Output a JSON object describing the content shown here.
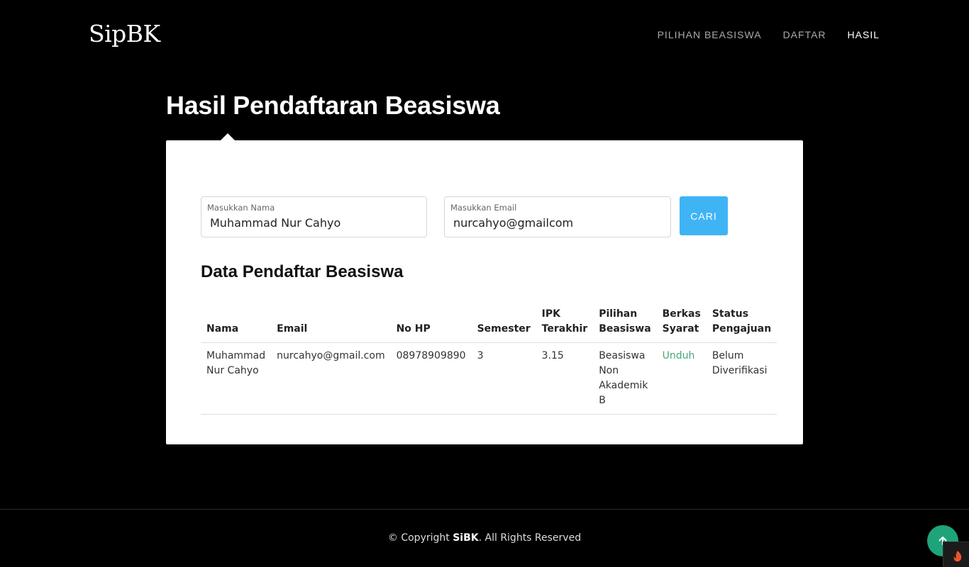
{
  "brand": {
    "logo": "SipBK"
  },
  "nav": {
    "items": [
      {
        "label": "PILIHAN BEASISWA",
        "active": false
      },
      {
        "label": "DAFTAR",
        "active": false
      },
      {
        "label": "HASIL",
        "active": true
      }
    ]
  },
  "page": {
    "title": "Hasil Pendaftaran Beasiswa"
  },
  "search": {
    "name_label": "Masukkan Nama",
    "name_value": "Muhammad Nur Cahyo",
    "email_label": "Masukkan Email",
    "email_value": "nurcahyo@gmailcom",
    "button_label": "CARI"
  },
  "results": {
    "title": "Data Pendaftar Beasiswa",
    "columns": [
      "Nama",
      "Email",
      "No HP",
      "Semester",
      "IPK Terakhir",
      "Pilihan Beasiswa",
      "Berkas Syarat",
      "Status Pengajuan"
    ],
    "rows": [
      {
        "nama": "Muhammad Nur Cahyo",
        "email": "nurcahyo@gmail.com",
        "no_hp": "08978909890",
        "semester": "3",
        "ipk": "3.15",
        "pilihan": "Beasiswa Non Akademik B",
        "berkas": "Unduh",
        "status": "Belum Diverifikasi"
      }
    ]
  },
  "footer": {
    "copyright_prefix": "© Copyright",
    "brand": "SiBK",
    "copyright_suffix": ". All Rights Reserved"
  },
  "icons": {
    "to_top": "arrow-up-icon"
  },
  "colors": {
    "accent": "#3fb4f5",
    "link": "#47a87a",
    "to_top": "#1fa37a"
  }
}
